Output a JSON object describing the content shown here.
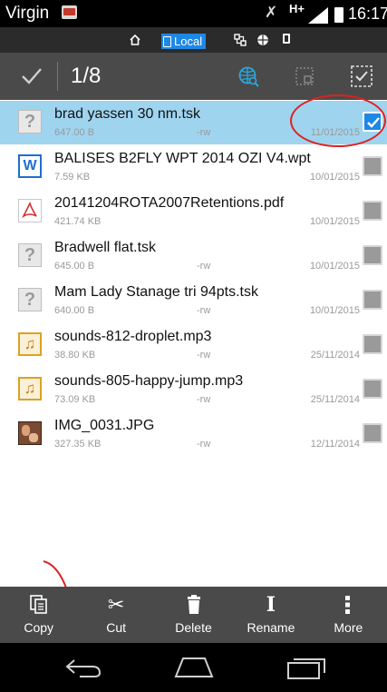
{
  "status_bar": {
    "carrier": "Virgin",
    "network_label": "H+",
    "time": "16:17"
  },
  "location_bar": {
    "local_label": "Local",
    "icons": [
      "home-icon",
      "device-icon",
      "network-icon",
      "globe-icon",
      "phone-icon"
    ]
  },
  "action_bar": {
    "selection_count": "1/8",
    "icons": [
      "check-icon",
      "globe-search-icon",
      "dotted-square-icon",
      "select-all-icon"
    ]
  },
  "files": [
    {
      "name": "brad yassen 30 nm.tsk",
      "size": "647.00 B",
      "perms": "-rw",
      "date": "11/01/2015",
      "type": "unknown",
      "checked": true
    },
    {
      "name": "BALISES B2FLY WPT 2014 OZI V4.wpt",
      "size": "7.59 KB",
      "perms": "",
      "date": "10/01/2015",
      "type": "doc",
      "checked": false
    },
    {
      "name": "20141204ROTA2007Retentions.pdf",
      "size": "421.74 KB",
      "perms": "",
      "date": "10/01/2015",
      "type": "pdf",
      "checked": false
    },
    {
      "name": "Bradwell flat.tsk",
      "size": "645.00 B",
      "perms": "-rw",
      "date": "10/01/2015",
      "type": "unknown",
      "checked": false
    },
    {
      "name": "Mam Lady Stanage tri 94pts.tsk",
      "size": "640.00 B",
      "perms": "-rw",
      "date": "10/01/2015",
      "type": "unknown",
      "checked": false
    },
    {
      "name": "sounds-812-droplet.mp3",
      "size": "38.80 KB",
      "perms": "-rw",
      "date": "25/11/2014",
      "type": "audio",
      "checked": false
    },
    {
      "name": "sounds-805-happy-jump.mp3",
      "size": "73.09 KB",
      "perms": "-rw",
      "date": "25/11/2014",
      "type": "audio",
      "checked": false
    },
    {
      "name": "IMG_0031.JPG",
      "size": "327.35 KB",
      "perms": "-rw",
      "date": "12/11/2014",
      "type": "image",
      "checked": false
    }
  ],
  "toolbar": {
    "copy_label": "Copy",
    "cut_label": "Cut",
    "delete_label": "Delete",
    "rename_label": "Rename",
    "more_label": "More"
  },
  "colors": {
    "selected_row": "#9fd4ef",
    "accent": "#1e88e5",
    "bar_background": "#4a4a4a",
    "annotation": "#e02020"
  }
}
